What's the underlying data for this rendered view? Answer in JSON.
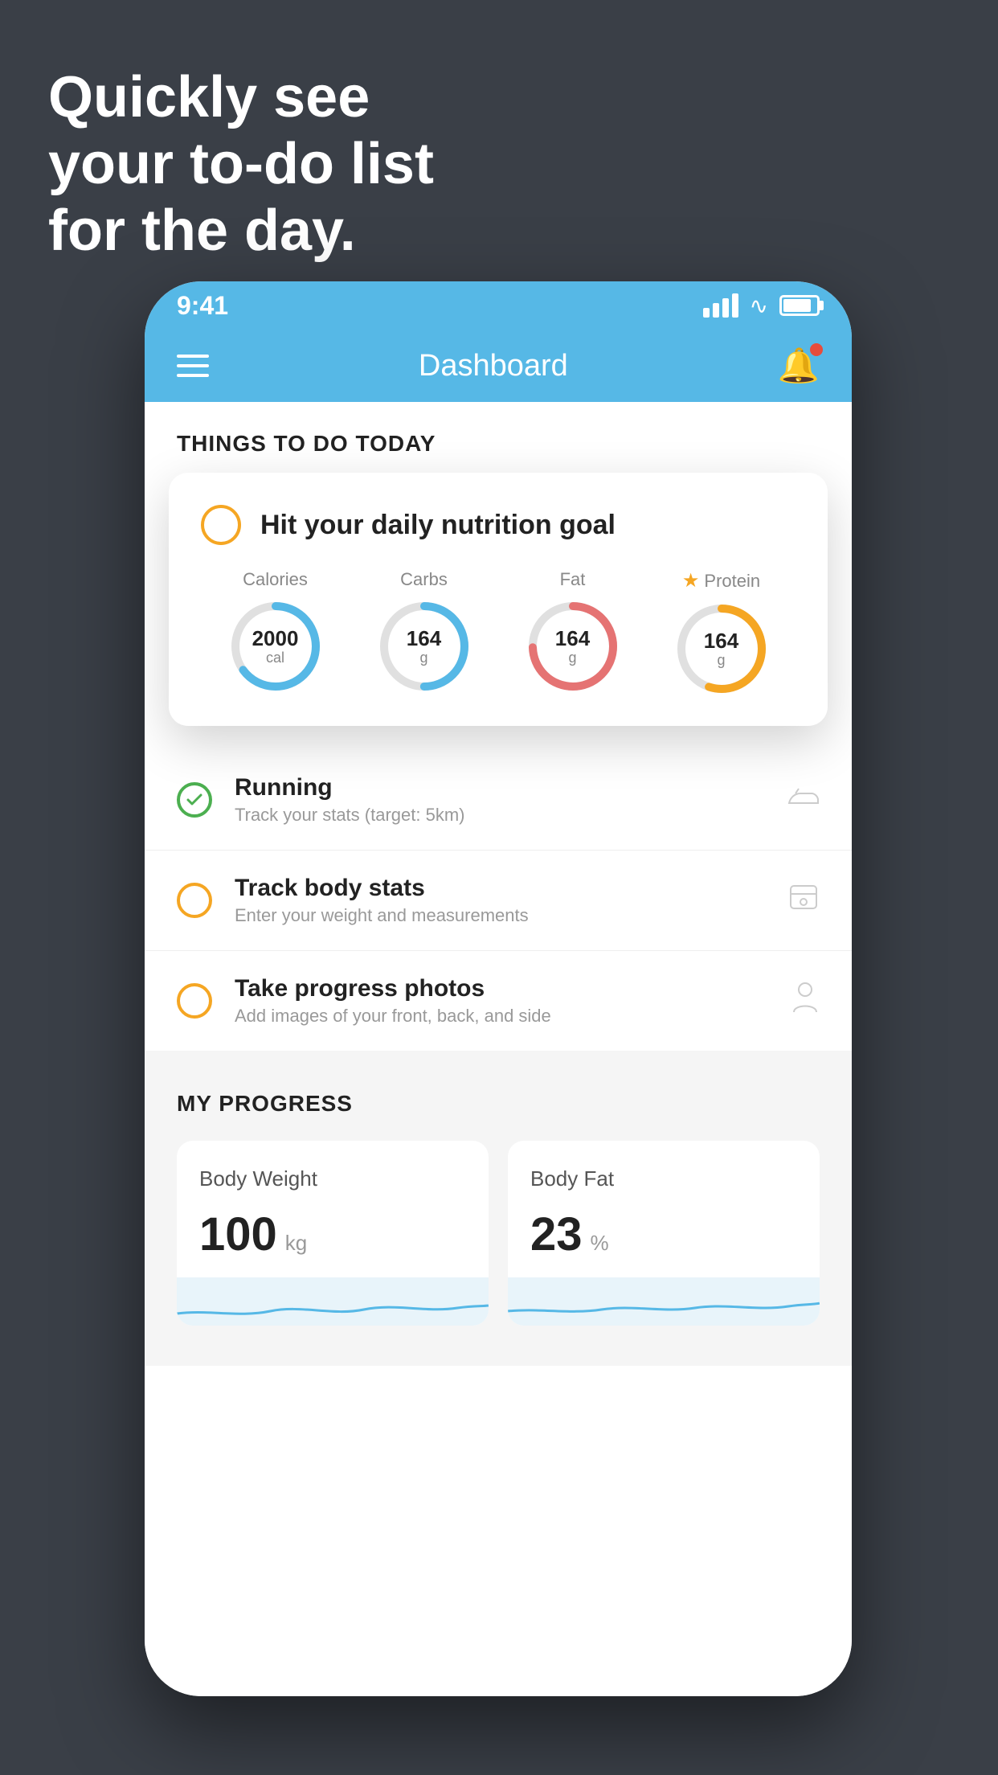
{
  "hero": {
    "line1": "Quickly see",
    "line2": "your to-do list",
    "line3": "for the day."
  },
  "status_bar": {
    "time": "9:41",
    "signal_bars": [
      12,
      18,
      24,
      30
    ],
    "wifi": "wifi",
    "battery": "battery"
  },
  "header": {
    "title": "Dashboard",
    "menu_icon": "menu",
    "bell_icon": "bell"
  },
  "things_section": {
    "heading": "THINGS TO DO TODAY"
  },
  "nutrition_card": {
    "title": "Hit your daily nutrition goal",
    "items": [
      {
        "label": "Calories",
        "value": "2000",
        "unit": "cal",
        "color": "#56b8e6",
        "track_color": "#e0e0e0",
        "progress": 65
      },
      {
        "label": "Carbs",
        "value": "164",
        "unit": "g",
        "color": "#56b8e6",
        "track_color": "#e0e0e0",
        "progress": 50
      },
      {
        "label": "Fat",
        "value": "164",
        "unit": "g",
        "color": "#e57373",
        "track_color": "#e0e0e0",
        "progress": 75
      },
      {
        "label": "Protein",
        "value": "164",
        "unit": "g",
        "color": "#f5a623",
        "track_color": "#e0e0e0",
        "progress": 55,
        "starred": true
      }
    ]
  },
  "todo_items": [
    {
      "title": "Running",
      "subtitle": "Track your stats (target: 5km)",
      "circle_color": "green",
      "icon": "shoe"
    },
    {
      "title": "Track body stats",
      "subtitle": "Enter your weight and measurements",
      "circle_color": "yellow",
      "icon": "scale"
    },
    {
      "title": "Take progress photos",
      "subtitle": "Add images of your front, back, and side",
      "circle_color": "yellow",
      "icon": "person"
    }
  ],
  "progress_section": {
    "heading": "MY PROGRESS",
    "cards": [
      {
        "title": "Body Weight",
        "value": "100",
        "unit": "kg"
      },
      {
        "title": "Body Fat",
        "value": "23",
        "unit": "%"
      }
    ]
  }
}
